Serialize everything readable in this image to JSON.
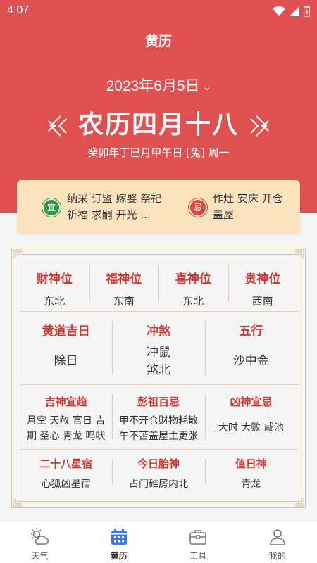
{
  "status_bar": {
    "time": "4:07"
  },
  "header": {
    "title": "黄历",
    "date": "2023年6月5日",
    "lunar_date": "农历四月十八",
    "ganzhi": "癸卯年丁巳月甲午日 [兔] 周一"
  },
  "yiji": {
    "yi_badge": "宜",
    "yi_text": "纳采 订盟 嫁娶 祭祀 祈福 求嗣 开光 ...",
    "ji_badge": "忌",
    "ji_text": "作灶 安床 开仓 盖屋"
  },
  "directions": [
    {
      "title": "财神位",
      "value": "东北"
    },
    {
      "title": "福神位",
      "value": "东南"
    },
    {
      "title": "喜神位",
      "value": "东北"
    },
    {
      "title": "贵神位",
      "value": "西南"
    }
  ],
  "day_info": [
    {
      "title": "黄道吉日",
      "value": "除日"
    },
    {
      "title": "冲煞",
      "value_lines": [
        "冲鼠",
        "煞北"
      ]
    },
    {
      "title": "五行",
      "value": "沙中金"
    }
  ],
  "detail_info": [
    {
      "title": "吉神宜趋",
      "value": "月空 天赦 官日 吉期 圣心 青龙 鸣吠"
    },
    {
      "title": "彭祖百忌",
      "value": "甲不开仓财物耗散 午不苫盖屋主更张"
    },
    {
      "title": "凶神宜忌",
      "value": "大时 大败 咸池"
    }
  ],
  "extra_info": [
    {
      "title": "二十八星宿",
      "value": "心狐凶星宿"
    },
    {
      "title": "今日胎神",
      "value": "占门碓房内北"
    },
    {
      "title": "值日神",
      "value": "青龙"
    }
  ],
  "bottom_nav": [
    {
      "label": "天气",
      "icon": "weather-icon"
    },
    {
      "label": "黄历",
      "icon": "calendar-icon",
      "active": true
    },
    {
      "label": "工具",
      "icon": "toolbox-icon"
    },
    {
      "label": "我的",
      "icon": "profile-icon"
    }
  ],
  "colors": {
    "header_red": "#e15051",
    "title_red": "#d03a35",
    "card_bg": "#fbe3bf",
    "yi_green": "#2f9a4f",
    "ji_red": "#d64a3b",
    "frame_gold": "#d9c6a3",
    "nav_active_blue": "#2f7df6"
  }
}
